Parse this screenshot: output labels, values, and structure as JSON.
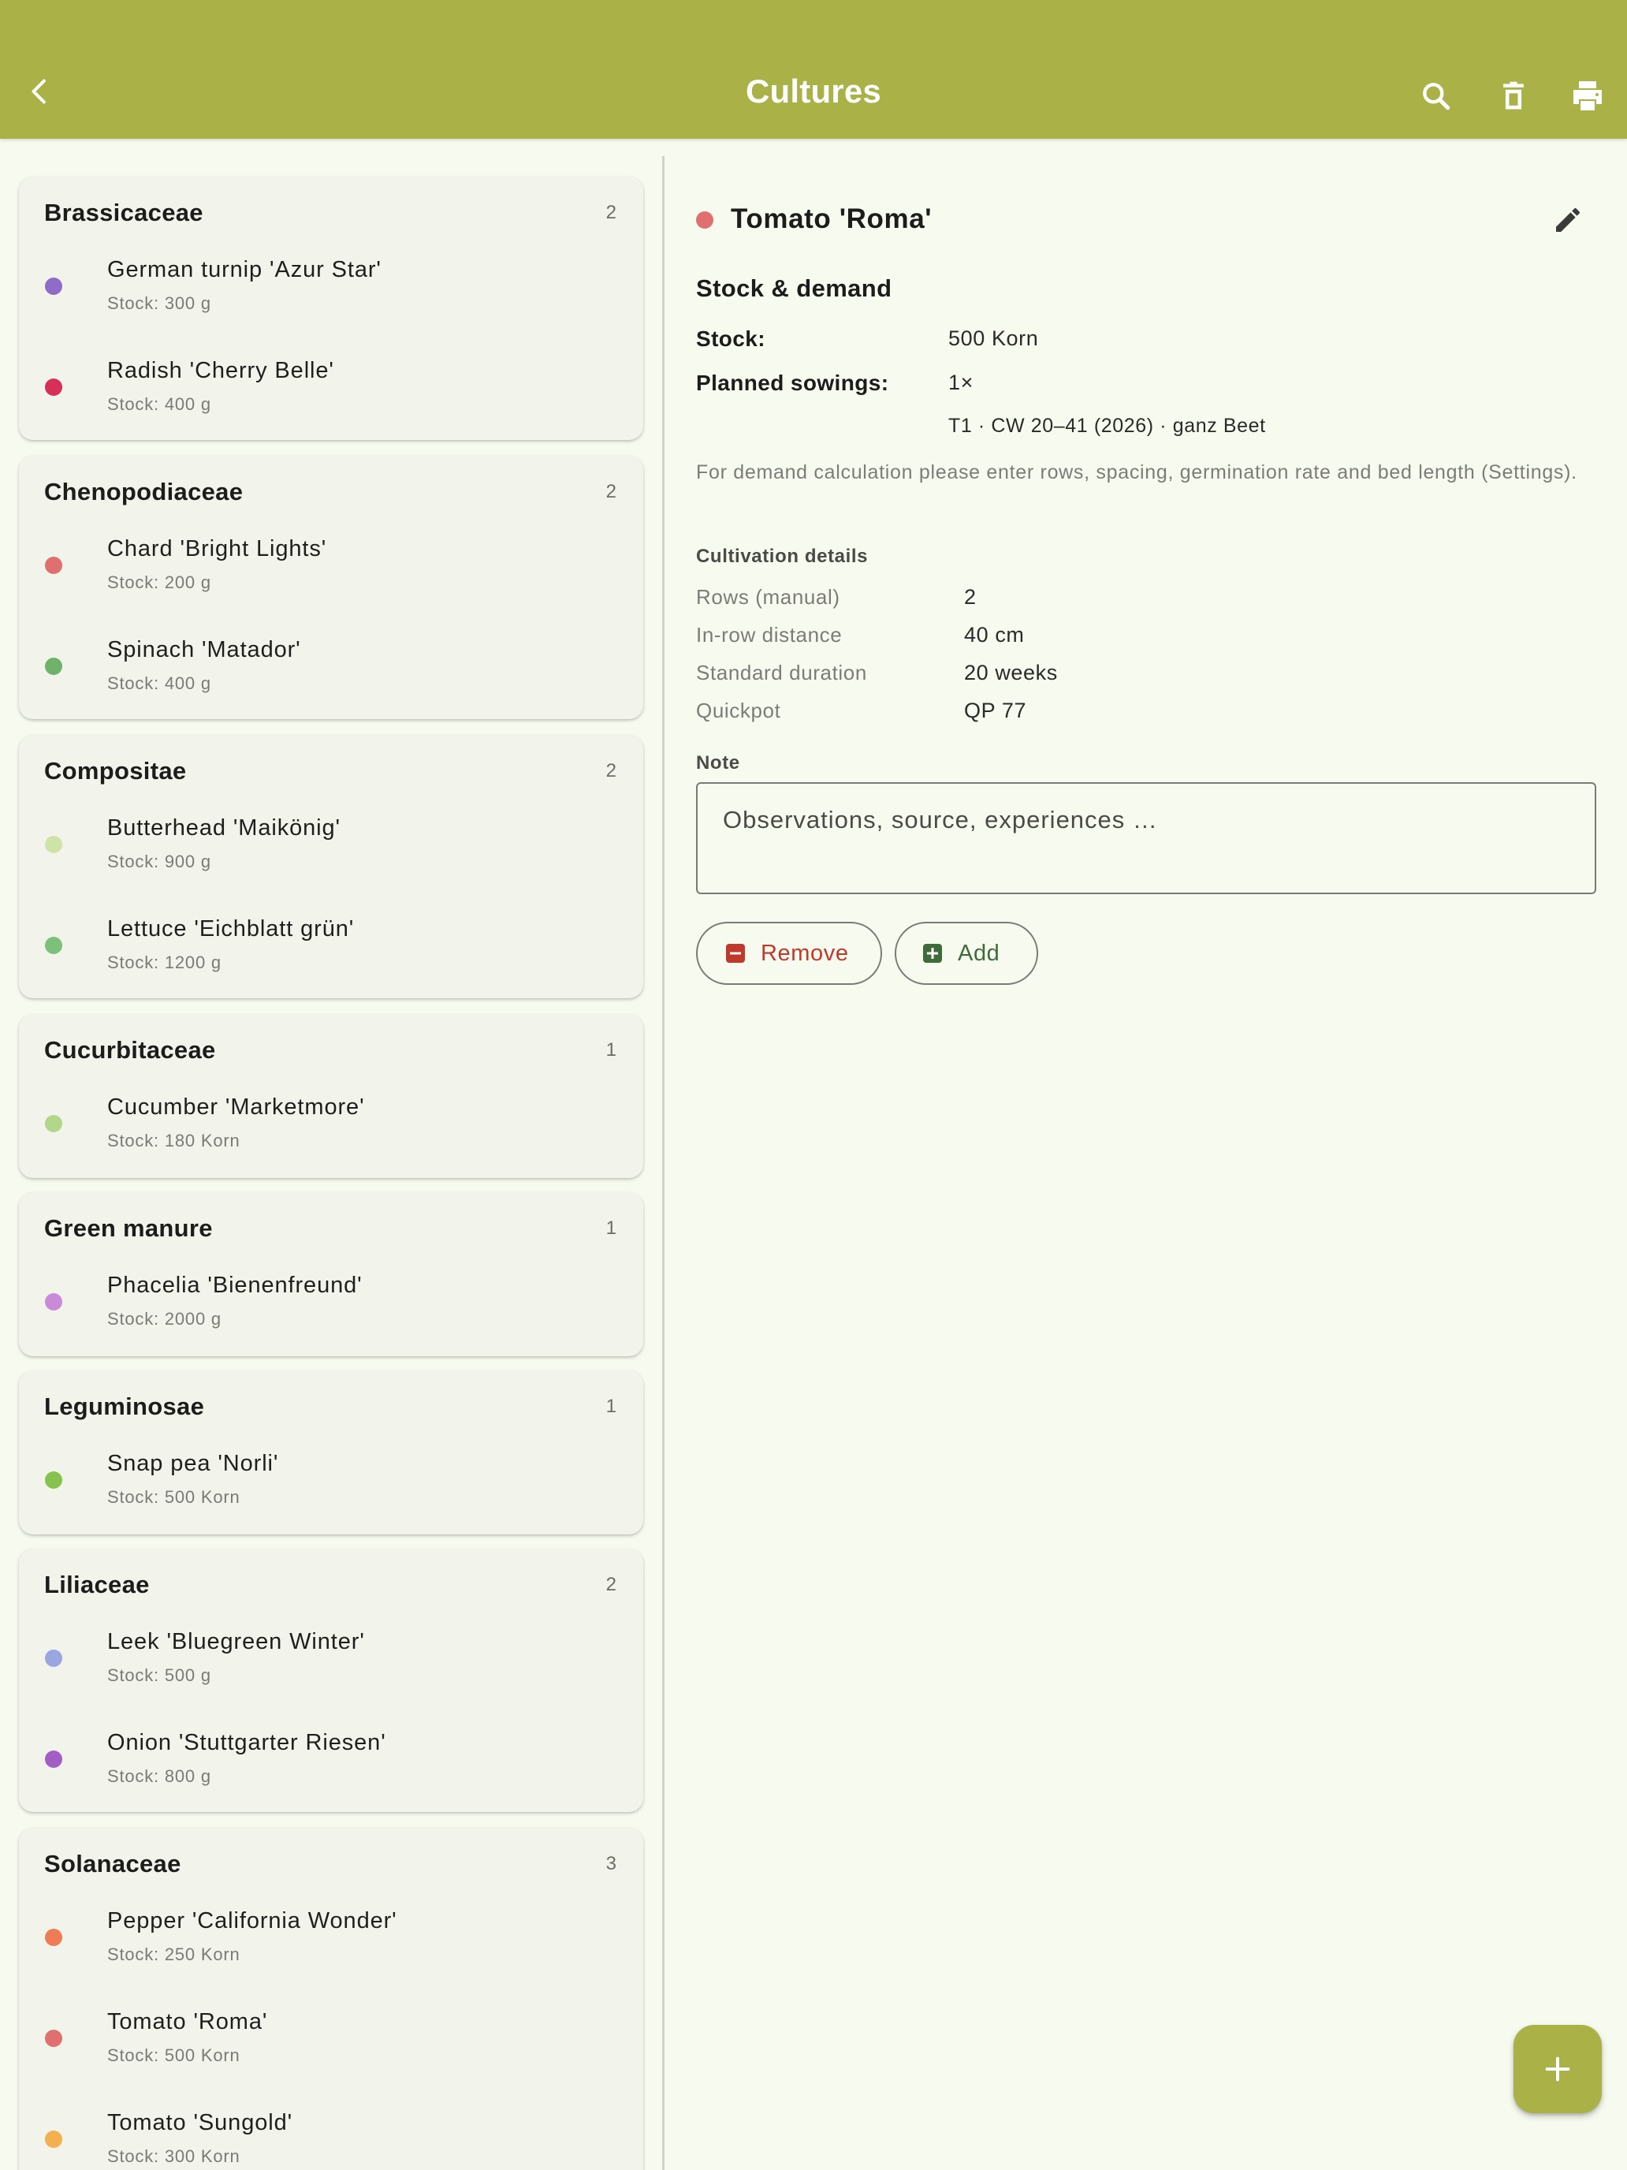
{
  "appbar": {
    "title": "Cultures",
    "icons": {
      "back": "chevron-left-icon",
      "search": "search-icon",
      "delete": "trash-icon",
      "print": "print-icon"
    }
  },
  "colors": {
    "accent": "#a9b147",
    "remove": "#c0392b",
    "add": "#3f6b3a"
  },
  "families": [
    {
      "name": "Brassicaceae",
      "count": "2",
      "items": [
        {
          "name": "German turnip 'Azur Star'",
          "stock": "Stock: 300 g",
          "color": "#8e6cc7"
        },
        {
          "name": "Radish 'Cherry Belle'",
          "stock": "Stock: 400 g",
          "color": "#d6305a"
        }
      ]
    },
    {
      "name": "Chenopodiaceae",
      "count": "2",
      "items": [
        {
          "name": "Chard 'Bright Lights'",
          "stock": "Stock: 200 g",
          "color": "#e07070"
        },
        {
          "name": "Spinach 'Matador'",
          "stock": "Stock: 400 g",
          "color": "#6fb26a"
        }
      ]
    },
    {
      "name": "Compositae",
      "count": "2",
      "items": [
        {
          "name": "Butterhead 'Maikönig'",
          "stock": "Stock: 900 g",
          "color": "#cfe3a8"
        },
        {
          "name": "Lettuce 'Eichblatt grün'",
          "stock": "Stock: 1200 g",
          "color": "#7cc07a"
        }
      ]
    },
    {
      "name": "Cucurbitaceae",
      "count": "1",
      "items": [
        {
          "name": "Cucumber 'Marketmore'",
          "stock": "Stock: 180 Korn",
          "color": "#b2d68a"
        }
      ]
    },
    {
      "name": "Green manure",
      "count": "1",
      "items": [
        {
          "name": "Phacelia 'Bienenfreund'",
          "stock": "Stock: 2000 g",
          "color": "#c98ad8"
        }
      ]
    },
    {
      "name": "Leguminosae",
      "count": "1",
      "items": [
        {
          "name": "Snap pea 'Norli'",
          "stock": "Stock: 500 Korn",
          "color": "#86c24e"
        }
      ]
    },
    {
      "name": "Liliaceae",
      "count": "2",
      "items": [
        {
          "name": "Leek 'Bluegreen Winter'",
          "stock": "Stock: 500 g",
          "color": "#9aa6e0"
        },
        {
          "name": "Onion 'Stuttgarter Riesen'",
          "stock": "Stock: 800 g",
          "color": "#a25ec2"
        }
      ]
    },
    {
      "name": "Solanaceae",
      "count": "3",
      "items": [
        {
          "name": "Pepper 'California Wonder'",
          "stock": "Stock: 250 Korn",
          "color": "#ee7d55"
        },
        {
          "name": "Tomato 'Roma'",
          "stock": "Stock: 500 Korn",
          "color": "#e07070"
        },
        {
          "name": "Tomato 'Sungold'",
          "stock": "Stock: 300 Korn",
          "color": "#f2b04e"
        }
      ]
    }
  ],
  "detail": {
    "title": "Tomato 'Roma'",
    "stock_heading": "Stock & demand",
    "stock_label": "Stock:",
    "stock_value": "500 Korn",
    "planned_label": "Planned sowings:",
    "planned_value": "1×",
    "planned_detail": "T1 · CW 20–41 (2026) · ganz Beet",
    "hint": "For demand calculation please enter rows, spacing, germination rate and bed length (Settings).",
    "cultivation_heading": "Cultivation details",
    "cultivation": [
      {
        "label": "Rows (manual)",
        "value": "2"
      },
      {
        "label": "In-row distance",
        "value": "40 cm"
      },
      {
        "label": "Standard duration",
        "value": "20 weeks"
      },
      {
        "label": "Quickpot",
        "value": "QP 77"
      }
    ],
    "note_label": "Note",
    "note_placeholder": "Observations, source, experiences …",
    "remove_label": "Remove",
    "add_label": "Add"
  }
}
